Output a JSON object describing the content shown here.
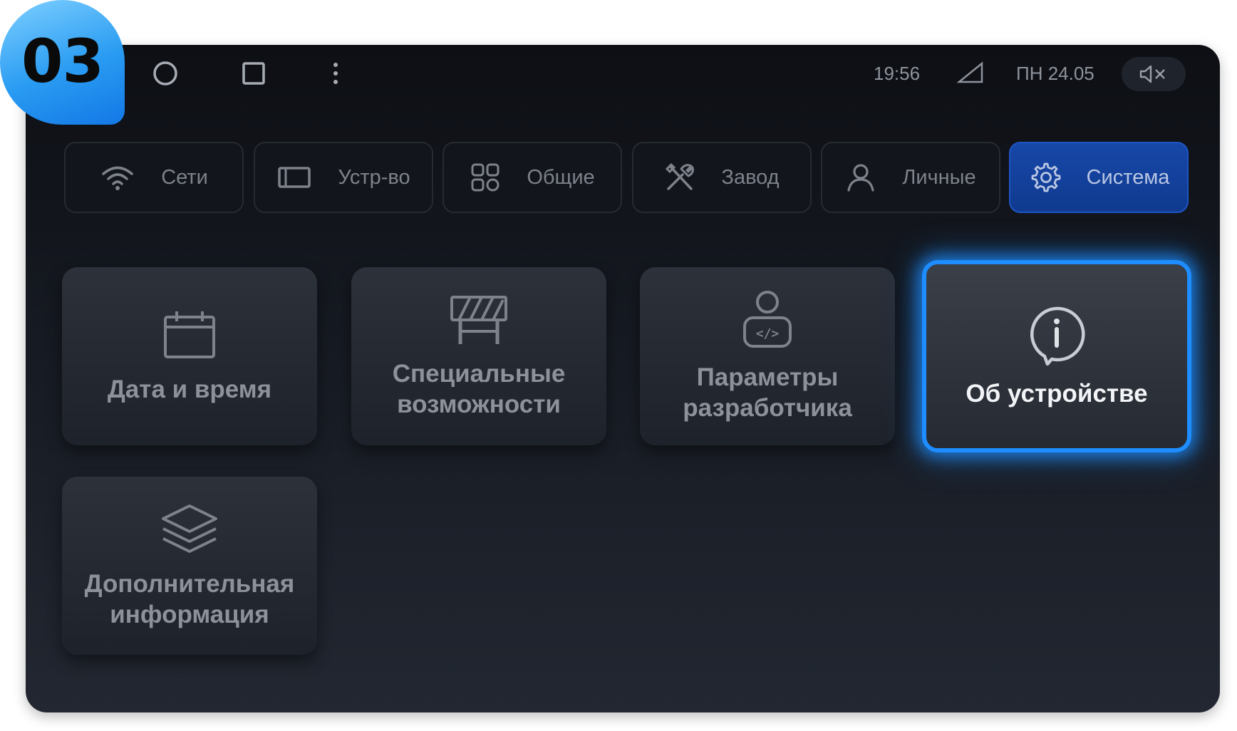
{
  "step_badge": "03",
  "nav_bar": {
    "icons": [
      "home-circle-icon",
      "recents-square-icon",
      "more-vertical-icon"
    ]
  },
  "status_bar": {
    "time": "19:56",
    "date": "ПН 24.05",
    "icons": [
      "signal-icon",
      "volume-muted-icon"
    ]
  },
  "tabs": [
    {
      "label": "Сети",
      "icon": "wifi-icon"
    },
    {
      "label": "Устр-во",
      "icon": "screen-icon"
    },
    {
      "label": "Общие",
      "icon": "grid-icon"
    },
    {
      "label": "Завод",
      "icon": "tools-icon"
    },
    {
      "label": "Личные",
      "icon": "person-icon"
    },
    {
      "label": "Система",
      "icon": "gear-icon",
      "active": true
    }
  ],
  "tiles": [
    {
      "label": "Дата и время",
      "icon": "calendar-icon"
    },
    {
      "label": "Специальные\nвозможности",
      "icon": "barrier-icon"
    },
    {
      "label": "Параметры\nразработчика",
      "icon": "developer-icon"
    },
    {
      "label": "Об устройстве",
      "icon": "info-icon",
      "selected": true
    },
    {
      "label": "Дополнительная\nинформация",
      "icon": "layers-icon"
    }
  ],
  "colors": {
    "accent": "#1e8dff",
    "active_tab": "#1747a8",
    "badge": "#2a9cf2"
  }
}
